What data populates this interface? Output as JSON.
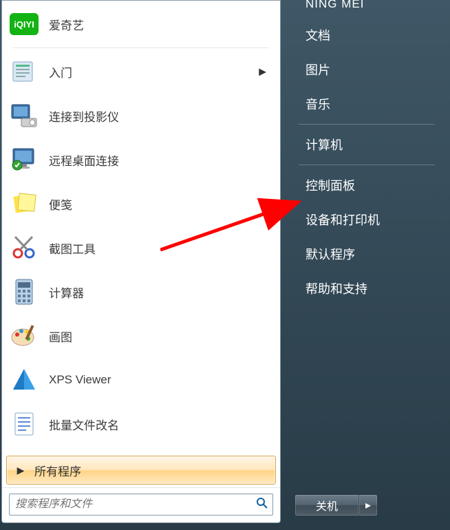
{
  "left": {
    "items": [
      {
        "label": "爱奇艺"
      },
      {
        "label": "入门",
        "has_submenu": true
      },
      {
        "label": "连接到投影仪"
      },
      {
        "label": "远程桌面连接"
      },
      {
        "label": "便笺"
      },
      {
        "label": "截图工具"
      },
      {
        "label": "计算器"
      },
      {
        "label": "画图"
      },
      {
        "label": "XPS Viewer"
      },
      {
        "label": "批量文件改名"
      }
    ],
    "all_programs": "所有程序",
    "search_placeholder": "搜索程序和文件"
  },
  "right": {
    "top_label": "NING MEI",
    "items_group1": [
      "文档",
      "图片",
      "音乐"
    ],
    "items_group2": [
      "计算机"
    ],
    "items_group3": [
      "控制面板",
      "设备和打印机",
      "默认程序",
      "帮助和支持"
    ],
    "shutdown": "关机"
  }
}
